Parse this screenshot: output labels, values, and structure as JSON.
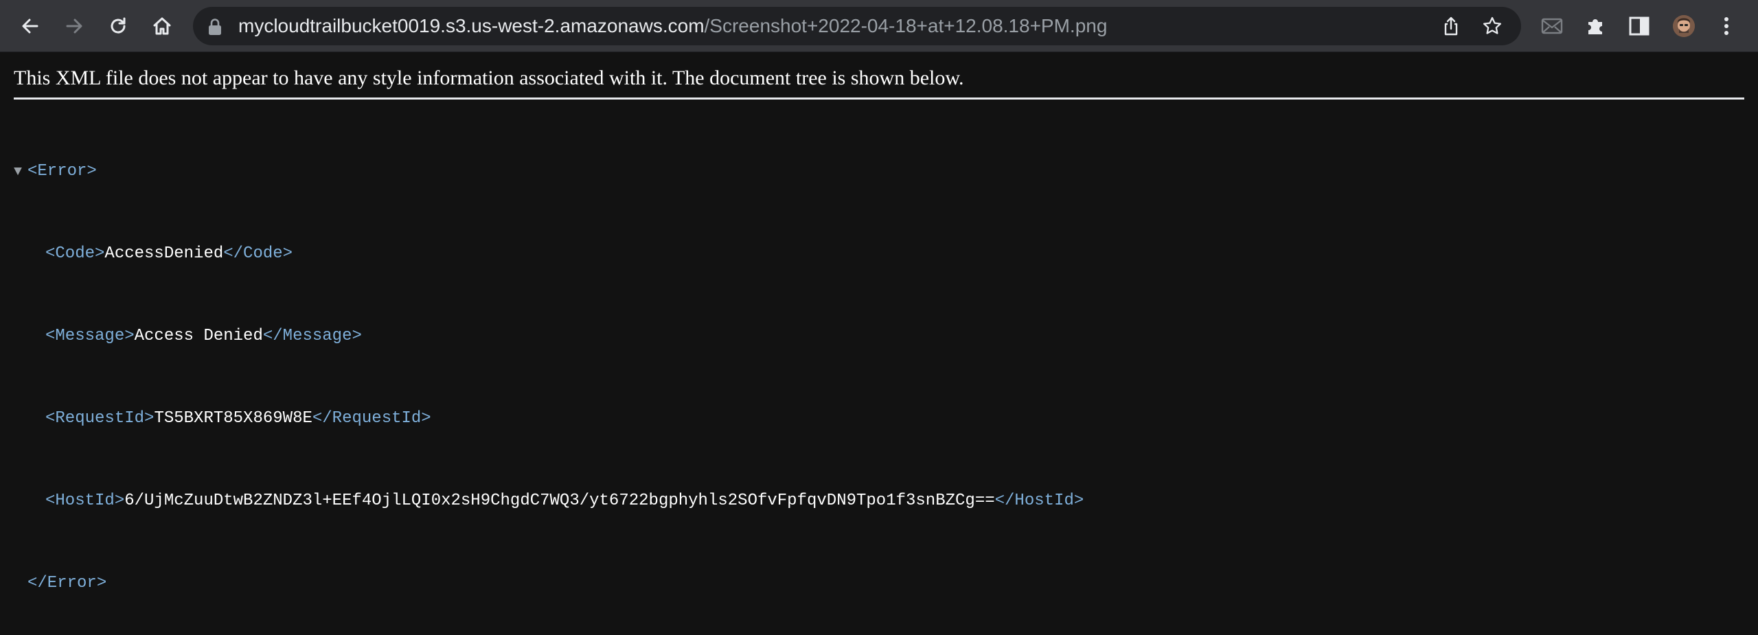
{
  "browser": {
    "url_host": "mycloudtrailbucket0019.s3.us-west-2.amazonaws.com",
    "url_path": "/Screenshot+2022-04-18+at+12.08.18+PM.png",
    "toolbar_icons": [
      "back-icon",
      "forward-icon",
      "reload-icon",
      "home-icon",
      "lock-icon",
      "share-icon",
      "bookmark-star-icon",
      "mail-icon",
      "extensions-puzzle-icon",
      "side-panel-icon",
      "profile-avatar",
      "menu-kebab-icon"
    ]
  },
  "page": {
    "notice": "This XML file does not appear to have any style information associated with it. The document tree is shown below.",
    "tree": {
      "toggle": "▼",
      "root_open": "<Error>",
      "root_close": "</Error>",
      "children": [
        {
          "open": "<Code>",
          "value": "AccessDenied",
          "close": "</Code>"
        },
        {
          "open": "<Message>",
          "value": "Access Denied",
          "close": "</Message>"
        },
        {
          "open": "<RequestId>",
          "value": "TS5BXRT85X869W8E",
          "close": "</RequestId>"
        },
        {
          "open": "<HostId>",
          "value": "6/UjMcZuuDtwB2ZNDZ3l+EEf4OjlLQI0x2sH9ChgdC7WQ3/yt6722bgphyhls2SOfvFpfqvDN9Tpo1f3snBZCg==",
          "close": "</HostId>"
        }
      ]
    }
  },
  "colors": {
    "toolbar_bg": "#35363a",
    "omnibox_bg": "#202124",
    "page_bg": "#121212",
    "tag_color": "#7fb0db",
    "text_color": "#ffffff"
  }
}
